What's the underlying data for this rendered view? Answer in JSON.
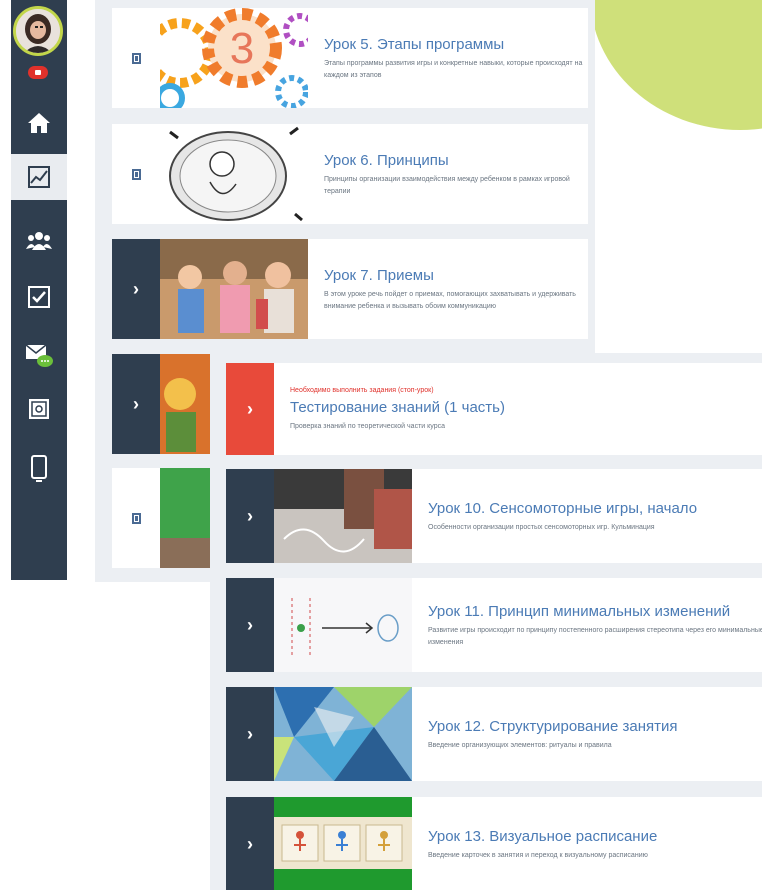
{
  "sidebar": {
    "items": [
      {
        "icon": "home-icon"
      },
      {
        "icon": "chart-icon"
      },
      {
        "icon": "group-icon"
      },
      {
        "icon": "checkbox-icon"
      },
      {
        "icon": "messages-icon"
      },
      {
        "icon": "safe-icon"
      },
      {
        "icon": "mobile-icon"
      }
    ]
  },
  "colors": {
    "sidebar": "#2f3e4f",
    "title": "#4b7bb5",
    "warning": "#e0312b",
    "accent_green": "#cfe07a"
  },
  "lessons_back": [
    {
      "title": "Урок 5. Этапы программы",
      "desc": "Этапы программы развития игры и конкретные навыки, которые происходят на каждом из этапов"
    },
    {
      "title": "Урок 6. Принципы",
      "desc": "Принципы организации взаимодействия между ребенком в рамках игровой терапии"
    },
    {
      "title": "Урок 7. Приемы",
      "desc": "В этом уроке речь пойдет о приемах, помогающих захватывать и удерживать внимание ребенка и вызывать обоим коммуникацию"
    }
  ],
  "lessons_front": [
    {
      "warning": "Необходимо выполнить задания (стоп-урок)",
      "title": "Тестирование знаний (1 часть)",
      "desc": "Проверка знаний по теоретической части курса"
    },
    {
      "title": "Урок 10. Сенсомоторные игры, начало",
      "desc": "Особенности организации простых сенсомоторных игр. Кульминация"
    },
    {
      "title": "Урок 11. Принцип минимальных изменений",
      "desc": "Развитие игры происходит по принципу постепенного расширения стереотипа через его минимальные изменения"
    },
    {
      "title": "Урок 12. Структурирование занятия",
      "desc": "Введение организующих элементов: ритуалы и правила"
    },
    {
      "title": "Урок 13. Визуальное расписание",
      "desc": "Введение карточек в занятия и переход к визуальному расписанию"
    }
  ]
}
